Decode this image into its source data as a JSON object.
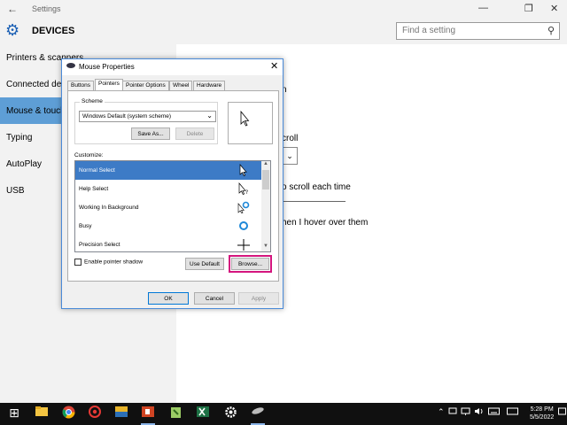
{
  "window": {
    "title": "Settings",
    "back_glyph": "←",
    "minimize_glyph": "—",
    "maximize_glyph": "❐",
    "close_glyph": "✕"
  },
  "header": {
    "title": "DEVICES",
    "gear_glyph": "⚙",
    "search_placeholder": "Find a setting",
    "search_glyph": "⚲"
  },
  "sidebar": {
    "items": [
      {
        "label": "Printers & scanners"
      },
      {
        "label": "Connected devices"
      },
      {
        "label": "Mouse & touchpad"
      },
      {
        "label": "Typing"
      },
      {
        "label": "AutoPlay"
      },
      {
        "label": "USB"
      }
    ]
  },
  "content": {
    "text1": "n",
    "text2": "croll",
    "text3": "o scroll each time",
    "text4": "hen I hover over them",
    "dropdown_glyph": "⌄"
  },
  "dialog": {
    "title": "Mouse Properties",
    "close_glyph": "✕",
    "tabs": [
      "Buttons",
      "Pointers",
      "Pointer Options",
      "Wheel",
      "Hardware"
    ],
    "scheme_label": "Scheme",
    "scheme_value": "Windows Default (system scheme)",
    "scheme_arrow": "⌄",
    "save_as_label": "Save As...",
    "delete_label": "Delete",
    "customize_label": "Customize:",
    "rows": [
      {
        "label": "Normal Select"
      },
      {
        "label": "Help Select"
      },
      {
        "label": "Working In Background"
      },
      {
        "label": "Busy"
      },
      {
        "label": "Precision Select"
      }
    ],
    "scroll_up": "▲",
    "scroll_down": "▼",
    "shadow_label": "Enable pointer shadow",
    "use_default_label": "Use Default",
    "browse_label": "Browse...",
    "ok_label": "OK",
    "cancel_label": "Cancel",
    "apply_label": "Apply"
  },
  "taskbar": {
    "start_glyph": "⊞",
    "tray_up_glyph": "⌃",
    "clock_time": "5:28 PM",
    "clock_date": "5/5/2022"
  },
  "colors": {
    "accent": "#5e9ed6",
    "selection": "#3d7bc6",
    "highlight": "#d4157e"
  }
}
